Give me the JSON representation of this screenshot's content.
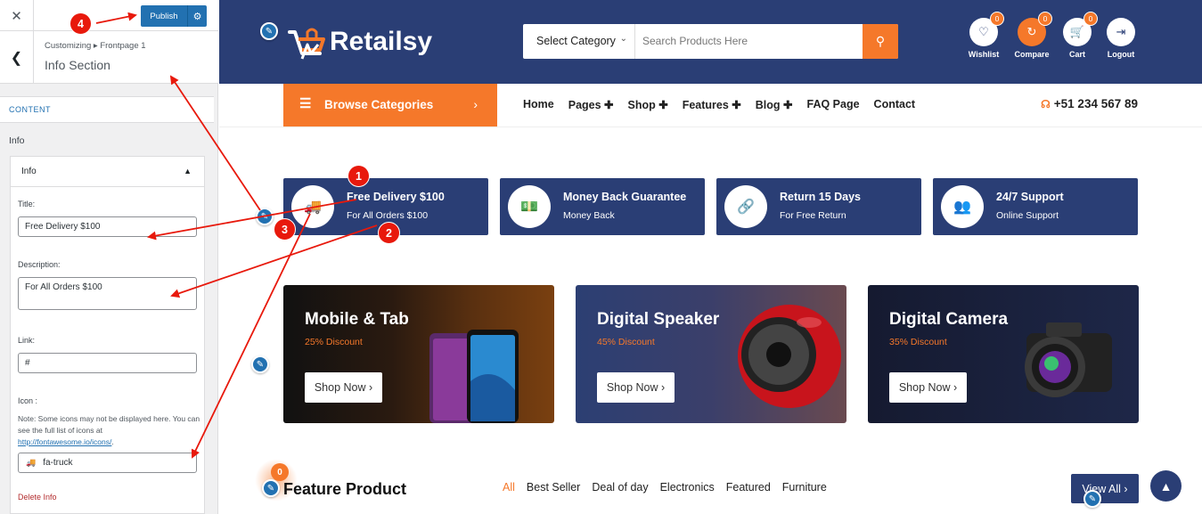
{
  "customizer": {
    "close_icon": "close-icon",
    "publish_label": "Publish",
    "breadcrumb": "Customizing ▸ Frontpage 1",
    "section_title": "Info Section",
    "content_tab": "CONTENT",
    "group_label": "Info",
    "item_label": "Info",
    "fields": {
      "title_label": "Title:",
      "title_value": "Free Delivery $100",
      "description_label": "Description:",
      "description_value": "For All Orders $100",
      "link_label": "Link:",
      "link_value": "#",
      "icon_label": "Icon :",
      "note_text": "Note: Some icons may not be displayed here. You can see the full list of icons at",
      "note_link": "http://fontawesome.io/icons/",
      "icon_value": "fa-truck"
    },
    "delete_label": "Delete Info"
  },
  "site": {
    "logo_text": "Retailsy",
    "search": {
      "category": "Select Category",
      "placeholder": "Search Products Here"
    },
    "header_icons": [
      {
        "label": "Wishlist",
        "count": "0",
        "icon": "heart-icon"
      },
      {
        "label": "Compare",
        "count": "0",
        "icon": "refresh-icon"
      },
      {
        "label": "Cart",
        "count": "0",
        "icon": "cart-icon"
      },
      {
        "label": "Logout",
        "icon": "logout-icon"
      }
    ],
    "browse_label": "Browse Categories",
    "menu": [
      "Home",
      "Pages ✚",
      "Shop ✚",
      "Features ✚",
      "Blog ✚",
      "FAQ Page",
      "Contact"
    ],
    "phone": "+51 234 567 89",
    "info_boxes": [
      {
        "title": "Free Delivery $100",
        "subtitle": "For All Orders $100",
        "icon": "truck-icon"
      },
      {
        "title": "Money Back Guarantee",
        "subtitle": "Money Back",
        "icon": "money-icon"
      },
      {
        "title": "Return 15 Days",
        "subtitle": "For Free Return",
        "icon": "link-icon"
      },
      {
        "title": "24/7 Support",
        "subtitle": "Online Support",
        "icon": "users-icon"
      }
    ],
    "banners": [
      {
        "title": "Mobile & Tab",
        "discount": "25% Discount",
        "button": "Shop Now ›"
      },
      {
        "title": "Digital Speaker",
        "discount": "45% Discount",
        "button": "Shop Now ›"
      },
      {
        "title": "Digital Camera",
        "discount": "35% Discount",
        "button": "Shop Now ›"
      }
    ],
    "feature": {
      "title": "Feature Product",
      "tabs": [
        "All",
        "Best Seller",
        "Deal of day",
        "Electronics",
        "Featured",
        "Furniture"
      ],
      "view_all": "View All ›",
      "badge": "0"
    }
  },
  "annotations": {
    "numbers": [
      "1",
      "2",
      "3",
      "4"
    ],
    "color": "#e8190c"
  },
  "colors": {
    "navy": "#2a3e75",
    "orange": "#f5782a",
    "wp_blue": "#2271b1"
  }
}
